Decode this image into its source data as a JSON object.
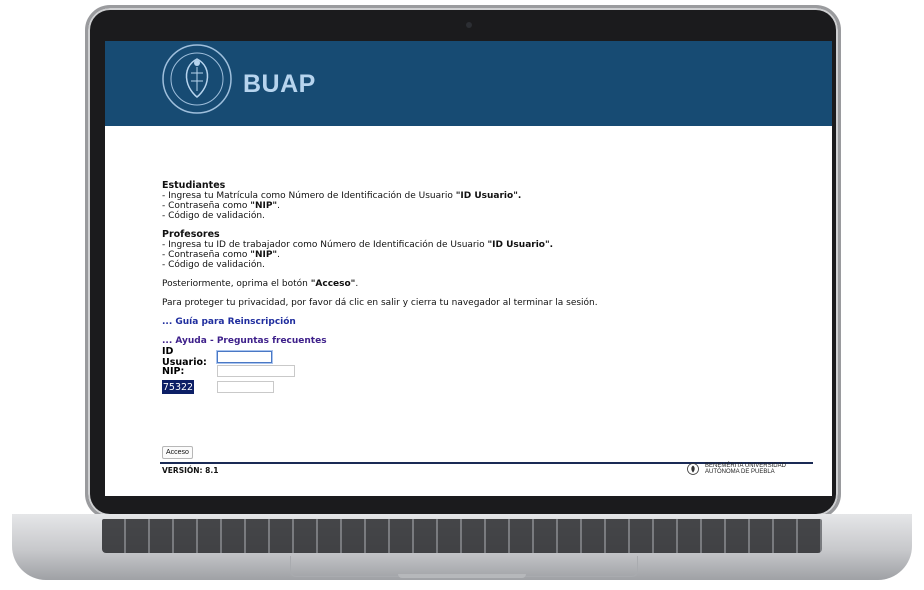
{
  "header": {
    "brand": "BUAP"
  },
  "instructions": {
    "students": {
      "title": "Estudiantes",
      "line1_prefix": "- Ingresa tu Matrícula como Número de Identificación de Usuario ",
      "line1_bold": "\"ID Usuario\".",
      "line2_prefix": "- Contraseña como ",
      "line2_bold": "\"NIP\"",
      "line2_suffix": ".",
      "line3": "- Código de validación."
    },
    "professors": {
      "title": "Profesores",
      "line1_prefix": "- Ingresa tu ID de trabajador como Número de Identificación de Usuario ",
      "line1_bold": "\"ID Usuario\".",
      "line2_prefix": "- Contraseña como ",
      "line2_bold": "\"NIP\"",
      "line2_suffix": ".",
      "line3": "- Código de validación."
    },
    "after_prefix": "Posteriormente, oprima el botón ",
    "after_bold": "\"Acceso\"",
    "after_suffix": ".",
    "privacy": "Para proteger tu privacidad, por favor dá clic en salir y cierra tu navegador al terminar la sesión."
  },
  "links": {
    "guide": "... Guía para Reinscripción",
    "help": "... Ayuda - Preguntas frecuentes"
  },
  "form": {
    "id_label": "ID Usuario:",
    "id_value": "",
    "nip_label": "NIP:",
    "nip_value": "",
    "captcha_code": "75322",
    "captcha_value": ""
  },
  "submit_label": "Acceso",
  "version": "VERSIÓN: 8.1",
  "footer": {
    "line1": "BENEMÉRITA UNIVERSIDAD",
    "line2": "AUTÓNOMA DE PUEBLA"
  },
  "colors": {
    "header_bg": "#174b73",
    "brand_text": "#b7d4ee",
    "link": "#1f2d9e",
    "captcha_bg": "#0d1f66"
  }
}
